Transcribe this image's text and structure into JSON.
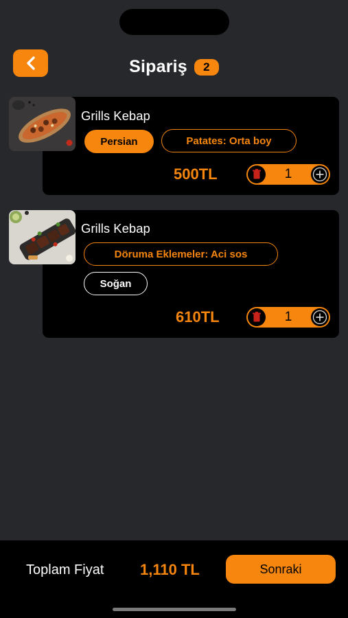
{
  "header": {
    "title": "Sipariş",
    "count": "2"
  },
  "items": [
    {
      "name": "Grills Kebap",
      "options": [
        "Persian",
        "Patates: Orta boy"
      ],
      "price": "500TL",
      "quantity": "1"
    },
    {
      "name": "Grills Kebap",
      "options": [
        "Döruma Eklemeler: Aci sos",
        "Soğan"
      ],
      "price": "610TL",
      "quantity": "1"
    }
  ],
  "footer": {
    "total_label": "Toplam Fiyat",
    "total_value": "1,110 TL",
    "next_label": "Sonraki"
  },
  "colors": {
    "accent": "#f7860f",
    "background": "#26282b",
    "card": "#000000"
  },
  "icons": {
    "back": "chevron-left-icon",
    "delete": "trash-icon",
    "add": "plus-icon"
  }
}
